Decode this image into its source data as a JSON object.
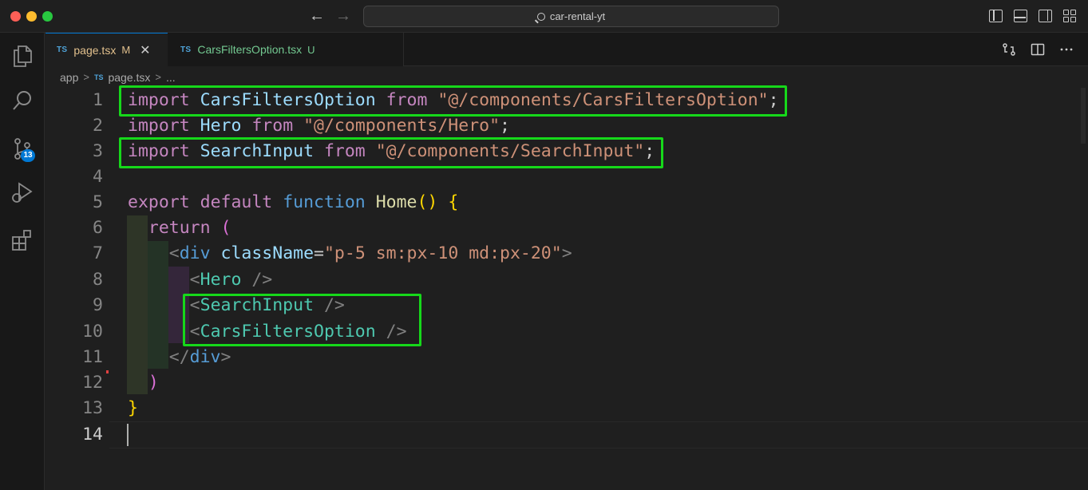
{
  "window": {
    "command_center": "car-rental-yt"
  },
  "activity_bar": {
    "source_control_badge": "13"
  },
  "tabs": [
    {
      "lang": "TS",
      "name": "page.tsx",
      "status": "M",
      "close": "✕"
    },
    {
      "lang": "TS",
      "name": "CarsFiltersOption.tsx",
      "status": "U"
    }
  ],
  "breadcrumb": {
    "folder": "app",
    "lang": "TS",
    "file": "page.tsx",
    "more": "..."
  },
  "editor": {
    "line_numbers": [
      "1",
      "2",
      "3",
      "4",
      "5",
      "6",
      "7",
      "8",
      "9",
      "10",
      "11",
      "12",
      "13",
      "14"
    ],
    "lines": {
      "l1": {
        "kw": "import",
        "ident": "CarsFiltersOption",
        "from": "from",
        "str": "\"@/components/CarsFiltersOption\"",
        "end": ";"
      },
      "l2": {
        "kw": "import",
        "ident": "Hero",
        "from": "from",
        "str": "\"@/components/Hero\"",
        "end": ";"
      },
      "l3": {
        "kw": "import",
        "ident": "SearchInput",
        "from": "from",
        "str": "\"@/components/SearchInput\"",
        "end": ";"
      },
      "l5": {
        "export": "export",
        "default": "default",
        "function": "function",
        "name": "Home",
        "parens": "()",
        "brace": "{"
      },
      "l6": {
        "ret": "return",
        "paren": "("
      },
      "l7": {
        "open": "<",
        "tag": "div",
        "attr": "className",
        "eq": "=",
        "val": "\"p-5 sm:px-10 md:px-20\"",
        "close": ">"
      },
      "l8": {
        "open": "<",
        "tag": "Hero",
        "close": " />"
      },
      "l9": {
        "open": "<",
        "tag": "SearchInput",
        "close": " />"
      },
      "l10": {
        "open": "<",
        "tag": "CarsFiltersOption",
        "close": " />"
      },
      "l11": {
        "open": "</",
        "tag": "div",
        "close": ">"
      },
      "l12": {
        "paren": ")"
      },
      "l13": {
        "brace": "}"
      }
    }
  },
  "colors": {
    "highlight_box": "#16d81a",
    "accent": "#0078d4"
  }
}
